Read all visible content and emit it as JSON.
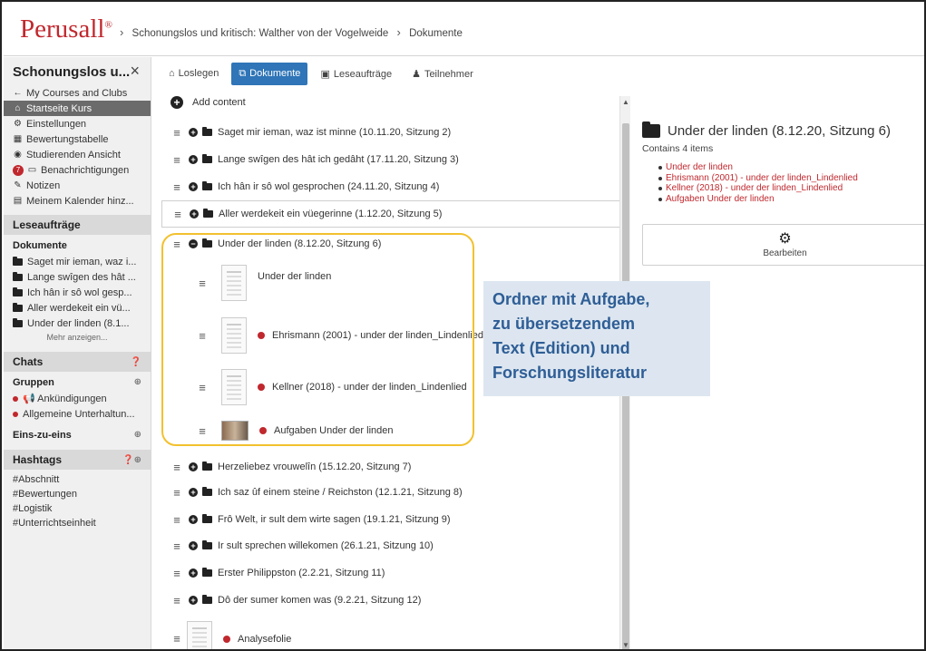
{
  "header": {
    "logo": "Perusall",
    "logo_mark": "®",
    "breadcrumb": [
      "Schonungslos und kritisch: Walther von der Vogelweide",
      "Dokumente"
    ]
  },
  "sidebar": {
    "course_title": "Schonungslos u...",
    "close_icon": "×",
    "nav": [
      {
        "icon": "arrow-left-icon",
        "glyph": "←",
        "label": "My Courses and Clubs"
      },
      {
        "icon": "home-icon",
        "glyph": "⌂",
        "label": "Startseite Kurs",
        "active": true
      },
      {
        "icon": "gear-icon",
        "glyph": "⚙",
        "label": "Einstellungen"
      },
      {
        "icon": "table-icon",
        "glyph": "▦",
        "label": "Bewertungstabelle"
      },
      {
        "icon": "eye-icon",
        "glyph": "◉",
        "label": "Studierenden Ansicht"
      },
      {
        "icon": "chat-icon",
        "glyph": "▭",
        "label": "Benachrichtigungen",
        "badge": "7"
      },
      {
        "icon": "pencil-icon",
        "glyph": "✎",
        "label": "Notizen"
      },
      {
        "icon": "calendar-icon",
        "glyph": "▤",
        "label": "Meinem Kalender hinz..."
      }
    ],
    "assignments_header": "Leseaufträge",
    "documents_header": "Dokumente",
    "documents": [
      "Saget mir ieman, waz i...",
      "Lange swîgen des hât ...",
      "Ich hân ir sô wol gesp...",
      "Aller werdekeit ein vü...",
      "Under der linden (8.1..."
    ],
    "more_label": "Mehr anzeigen...",
    "chats_header": "Chats",
    "groups_header": "Gruppen",
    "groups": [
      "📢 Ankündigungen",
      "Allgemeine Unterhaltun..."
    ],
    "one_to_one": "Eins-zu-eins",
    "hashtags_header": "Hashtags",
    "hashtags": [
      "#Abschnitt",
      "#Bewertungen",
      "#Logistik",
      "#Unterrichtseinheit"
    ]
  },
  "tabs": [
    {
      "icon": "home-icon",
      "glyph": "⌂",
      "label": "Loslegen"
    },
    {
      "icon": "copy-icon",
      "glyph": "⧉",
      "label": "Dokumente",
      "active": true
    },
    {
      "icon": "calendar-check-icon",
      "glyph": "▣",
      "label": "Leseaufträge"
    },
    {
      "icon": "user-icon",
      "glyph": "♟",
      "label": "Teilnehmer"
    }
  ],
  "add_content": "Add content",
  "folders_top": [
    "Saget mir ieman, waz ist minne (10.11.20, Sitzung 2)",
    "Lange swîgen des hât ich gedâht (17.11.20, Sitzung 3)",
    "Ich hân ir sô wol gesprochen (24.11.20, Sitzung 4)",
    "Aller werdekeit ein vüegerinne (1.12.20, Sitzung 5)"
  ],
  "open_folder": {
    "label": "Under der linden (8.12.20, Sitzung 6)",
    "items": [
      {
        "label": "Under der linden",
        "dot": false
      },
      {
        "label": "Ehrismann (2001) - under der linden_Lindenlied",
        "dot": true
      },
      {
        "label": "Kellner (2018) - under der linden_Lindenlied",
        "dot": true
      },
      {
        "label": "Aufgaben Under der linden",
        "dot": true
      }
    ]
  },
  "folders_bottom": [
    "Herzeliebez vrouwelîn (15.12.20, Sitzung 7)",
    "Ich saz ûf einem steine / Reichston (12.1.21, Sitzung 8)",
    "Frô Welt, ir sult dem wirte sagen (19.1.21, Sitzung 9)",
    "Ir sult sprechen willekomen (26.1.21, Sitzung 10)",
    "Erster Philippston (2.2.21, Sitzung 11)",
    "Dô der sumer komen was (9.2.21, Sitzung 12)"
  ],
  "last_item": "Analysefolie",
  "callout_lines": [
    "Ordner mit Aufgabe,",
    "zu übersetzendem",
    "Text (Edition) und",
    "Forschungsliteratur"
  ],
  "panel": {
    "title": "Under der linden (8.12.20, Sitzung 6)",
    "count": "Contains 4 items",
    "items": [
      "Under der linden",
      "Ehrismann (2001) - under der linden_Lindenlied",
      "Kellner (2018) - under der linden_Lindenlied",
      "Aufgaben Under der linden"
    ],
    "edit_label": "Bearbeiten"
  },
  "colors": {
    "brand": "#c0282e",
    "accent": "#2f75b7",
    "highlight": "#f2c12e",
    "callout_bg": "#dde6f0",
    "callout_text": "#2e5e96"
  }
}
